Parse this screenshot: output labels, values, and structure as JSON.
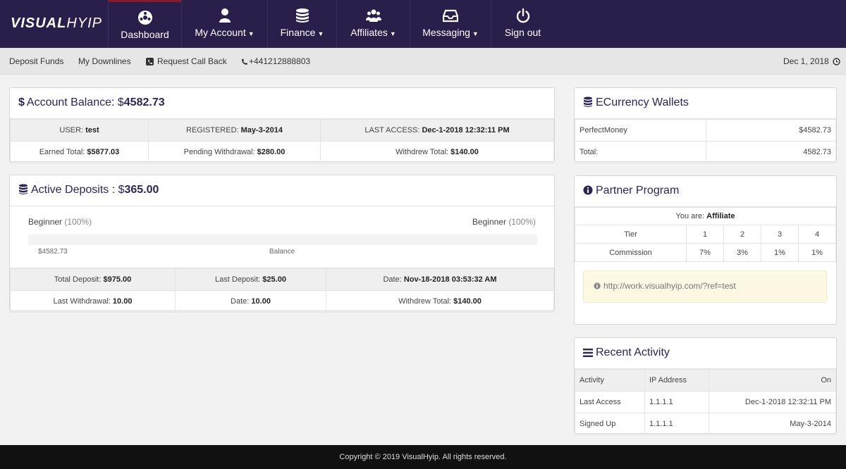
{
  "brand": {
    "bold": "VISUAL",
    "thin": "HYIP"
  },
  "nav": {
    "dashboard": "Dashboard",
    "account": "My Account",
    "finance": "Finance",
    "affiliates": "Affiliates",
    "messaging": "Messaging",
    "signout": "Sign out"
  },
  "subbar": {
    "deposit": "Deposit Funds",
    "downlines": "My Downlines",
    "callback": "Request Call Back",
    "phone": "+441212888803",
    "date": "Dec 1, 2018"
  },
  "balance": {
    "title": "Account Balance: $",
    "amount": "4582.73",
    "user_label": "USER: ",
    "user": "test",
    "registered_label": "REGISTERED: ",
    "registered": "May-3-2014",
    "last_access_label": "LAST ACCESS: ",
    "last_access": "Dec-1-2018 12:32:11 PM",
    "earned_label": "Earned Total: ",
    "earned": "$5877.03",
    "pending_label": "Pending Withdrawal: ",
    "pending": "$280.00",
    "withdrew_label": "Withdrew Total: ",
    "withdrew": "$140.00"
  },
  "deposits": {
    "title": "Active Deposits : $",
    "amount": "365.00",
    "left_plan": "Beginner",
    "left_pct": "(100%)",
    "right_plan": "Beginner",
    "right_pct": "(100%)",
    "progress": 1.0,
    "bar_value": "$4582.73",
    "bar_caption": "Balance",
    "total_label": "Total Deposit: ",
    "total": "$975.00",
    "last_dep_label": "Last Deposit: ",
    "last_dep": "$25.00",
    "date_label": "Date: ",
    "date": "Nov-18-2018 03:53:32 AM",
    "last_wd_label": "Last Withdrawal: ",
    "last_wd": "10.00",
    "date2_label": "Date: ",
    "date2": "10.00",
    "withdrew_label": "Withdrew Total: ",
    "withdrew": "$140.00"
  },
  "wallets": {
    "title": "ECurrency Wallets",
    "rows": [
      {
        "name": "PerfectMoney",
        "value": "$4582.73"
      },
      {
        "name": "Total:",
        "value": "4582.73"
      }
    ]
  },
  "partner": {
    "title": "Partner Program",
    "you_are_label": "You are: ",
    "you_are": "Affiliate",
    "tier_label": "Tier",
    "tiers": [
      "1",
      "2",
      "3",
      "4"
    ],
    "commission_label": "Commission",
    "commissions": [
      "7%",
      "3%",
      "1%",
      "1%"
    ],
    "ref_link": "http://work.visualhyip.com/?ref=test"
  },
  "activity": {
    "title": "Recent Activity",
    "headers": [
      "Activity",
      "IP Address",
      "On"
    ],
    "rows": [
      [
        "Last Access",
        "1.1.1.1",
        "Dec-1-2018 12:32:11 PM"
      ],
      [
        "Signed Up",
        "1.1.1.1",
        "May-3-2014"
      ]
    ]
  },
  "footer": "Copyright © 2019 VisualHyip. All rights reserved.",
  "colors": {
    "nav_bg": "#2a1e4a",
    "accent_text": "#2b2556",
    "active_border": "#8a1a2a",
    "footer_bg": "#111111",
    "note_bg": "#fcf8e3"
  }
}
